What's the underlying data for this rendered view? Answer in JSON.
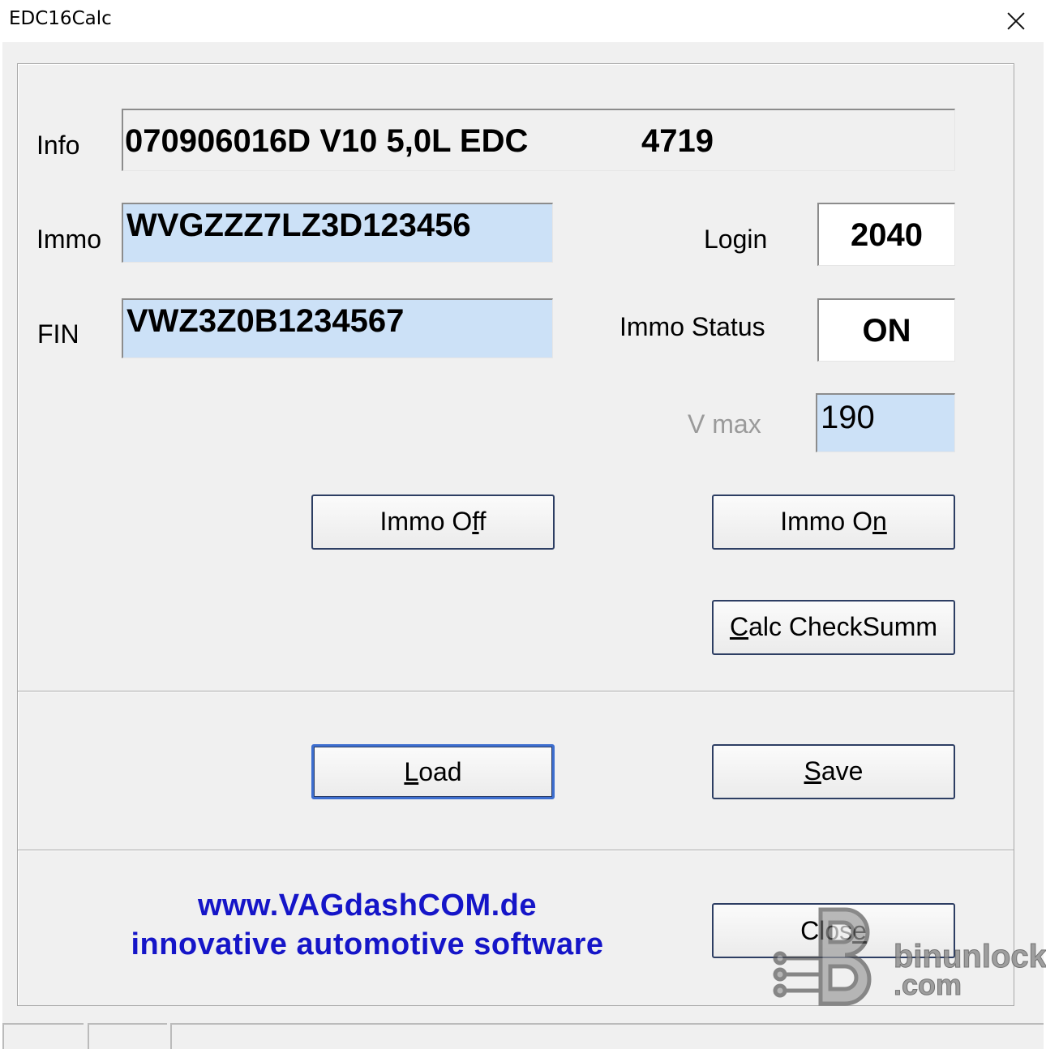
{
  "window": {
    "title": "EDC16Calc"
  },
  "info": {
    "label": "Info",
    "value_part1": "070906016D  V10 5,0L EDC",
    "value_part2": "4719"
  },
  "immo": {
    "label": "Immo",
    "value": "WVGZZZ7LZ3D123456"
  },
  "fin": {
    "label": "FIN",
    "value": "VWZ3Z0B1234567"
  },
  "login": {
    "label": "Login",
    "value": "2040"
  },
  "immo_status": {
    "label": "Immo Status",
    "value": "ON"
  },
  "vmax": {
    "label": "V max",
    "value": "190"
  },
  "buttons": {
    "immo_off": {
      "pre": "Immo O",
      "accel": "f",
      "post": "f"
    },
    "immo_on": {
      "pre": "Immo O",
      "accel": "n",
      "post": ""
    },
    "calc": {
      "pre": "",
      "accel": "C",
      "post": "alc CheckSumm"
    },
    "load": {
      "pre": "",
      "accel": "L",
      "post": "oad"
    },
    "save": {
      "pre": "",
      "accel": "S",
      "post": "ave"
    },
    "close": {
      "pre": "Clos",
      "accel": "e",
      "post": ""
    }
  },
  "promo": {
    "line1": "www.VAGdashCOM.de",
    "line2": "innovative automotive software"
  },
  "watermark": {
    "brand": "binunlock",
    "domain": ".com"
  },
  "colors": {
    "edit_bg": "#cce1f7",
    "promo_text": "#1515c8",
    "default_button_border": "#3d6ecf"
  }
}
